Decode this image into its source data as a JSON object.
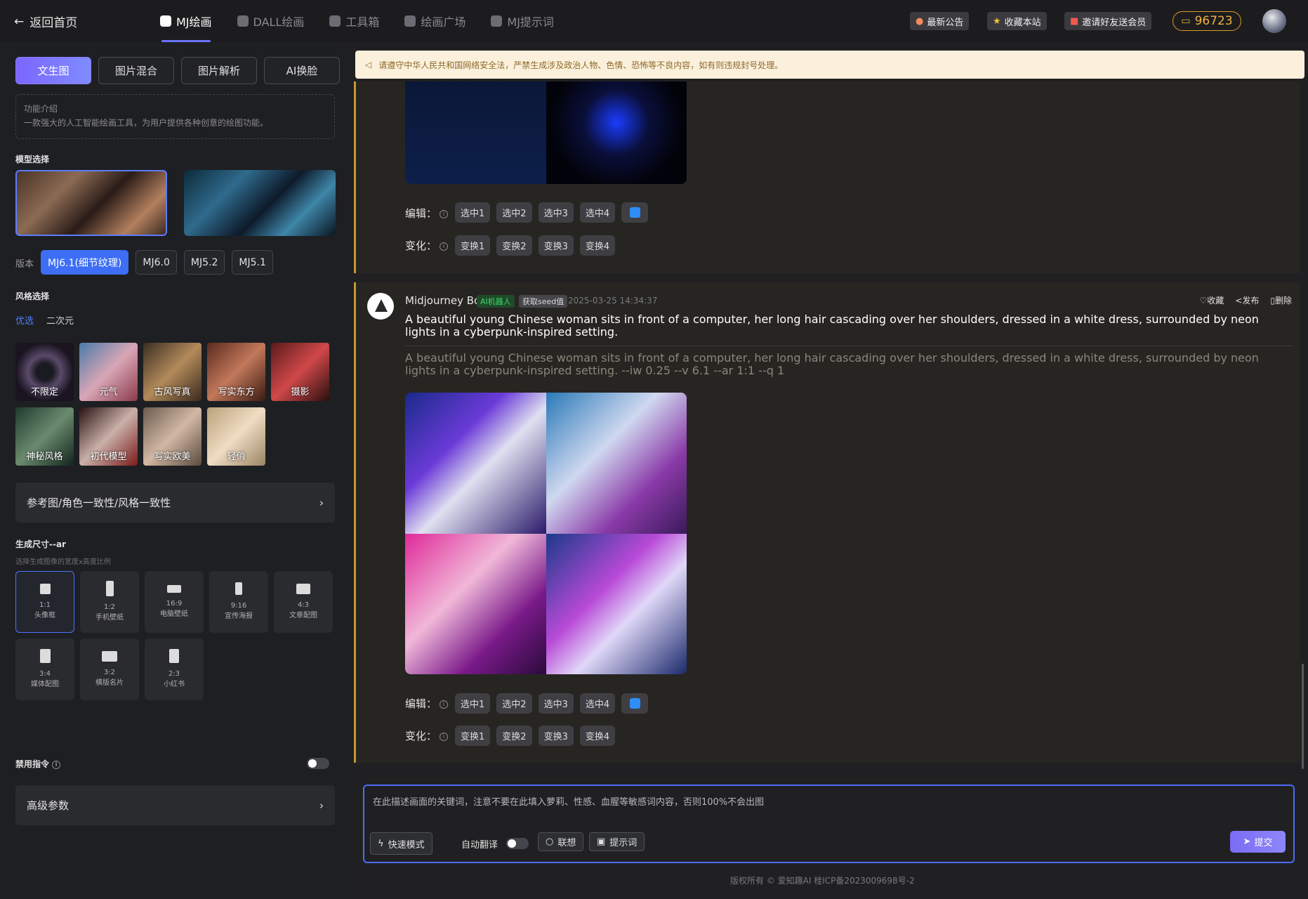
{
  "topbar": {
    "back_label": "返回首页",
    "tabs": [
      {
        "label": "MJ绘画",
        "icon": "palette-icon"
      },
      {
        "label": "DALL绘画",
        "icon": "palette-icon"
      },
      {
        "label": "工具箱",
        "icon": "toolbox-icon"
      },
      {
        "label": "绘画广场",
        "icon": "plaza-icon"
      },
      {
        "label": "MJ提示词",
        "icon": "prompt-icon"
      }
    ],
    "active_tab": "MJ绘画",
    "buttons": {
      "announcement": "最新公告",
      "bookmark": "收藏本站",
      "invite": "邀请好友送会员"
    },
    "balance": "96723",
    "accent_color": "#6a74ff"
  },
  "sidebar": {
    "mode_tabs": [
      "文生图",
      "图片混合",
      "图片解析",
      "AI换脸"
    ],
    "active_mode": "文生图",
    "intro_title": "功能介绍",
    "intro_text": "一款强大的人工智能绘画工具，为用户提供各种创意的绘图功能。",
    "model_section": "模型选择",
    "version_label": "版本",
    "versions": [
      "MJ6.1(细节纹理)",
      "MJ6.0",
      "MJ5.2",
      "MJ5.1"
    ],
    "active_version": "MJ6.1(细节纹理)",
    "style_section": "风格选择",
    "style_tabs": [
      "优选",
      "二次元"
    ],
    "styles": [
      "不限定",
      "元气",
      "古风写真",
      "写实东方",
      "摄影",
      "神秘风格",
      "初代模型",
      "写实欧美",
      "轻俏"
    ],
    "ref_label": "参考图/角色一致性/风格一致性",
    "size_section": "生成尺寸--ar",
    "size_subtitle": "选择生成图像的宽度x高度比例",
    "sizes": [
      {
        "ratio": "1:1",
        "label": "头像框"
      },
      {
        "ratio": "1:2",
        "label": "手机壁纸"
      },
      {
        "ratio": "16:9",
        "label": "电脑壁纸"
      },
      {
        "ratio": "9:16",
        "label": "宣传海报"
      },
      {
        "ratio": "4:3",
        "label": "文章配图"
      },
      {
        "ratio": "3:4",
        "label": "媒体配图"
      },
      {
        "ratio": "3:2",
        "label": "横版名片"
      },
      {
        "ratio": "2:3",
        "label": "小红书"
      }
    ],
    "active_size": "1:1",
    "disable_label": "禁用指令",
    "disable_on": false,
    "advanced_label": "高级参数"
  },
  "notice": "请遵守中华人民共和国网络安全法，严禁生成涉及政治人物、色情、恐怖等不良内容，如有则违规封号处理。",
  "messages": [
    {
      "edit_label": "编辑：",
      "edit_chips": [
        "选中1",
        "选中2",
        "选中3",
        "选中4"
      ],
      "vary_label": "变化：",
      "vary_chips": [
        "变换1",
        "变换2",
        "变换3",
        "变换4"
      ]
    },
    {
      "bot_name": "Midjourney Bot",
      "ai_badge": "AI机器人",
      "seed_badge": "获取seed值",
      "timestamp": "2025-03-25 14:34:37",
      "actions": {
        "favorite": "收藏",
        "publish": "发布",
        "delete": "删除"
      },
      "prompt": "A beautiful young Chinese woman sits in front of a computer, her long hair cascading over her shoulders, dressed in a white dress, surrounded by neon lights in a cyberpunk-inspired setting.",
      "full_prompt": "A beautiful young Chinese woman sits in front of a computer, her long hair cascading over her shoulders, dressed in a white dress, surrounded by neon lights in a cyberpunk-inspired setting. --iw 0.25 --v 6.1 --ar 1:1 --q 1",
      "edit_label": "编辑：",
      "edit_chips": [
        "选中1",
        "选中2",
        "选中3",
        "选中4"
      ],
      "vary_label": "变化：",
      "vary_chips": [
        "变换1",
        "变换2",
        "变换3",
        "变换4"
      ]
    }
  ],
  "input": {
    "placeholder": "在此描述画面的关键词，注意不要在此填入萝莉、性感、血腥等敏感词内容，否则100%不会出图",
    "fast_mode": "快速模式",
    "auto_translate": "自动翻译",
    "auto_translate_on": false,
    "associate": "联想",
    "prompt_words": "提示词",
    "submit": "提交"
  },
  "footer": "版权所有 © 爱知趣AI 桂ICP备2023009698号-2"
}
